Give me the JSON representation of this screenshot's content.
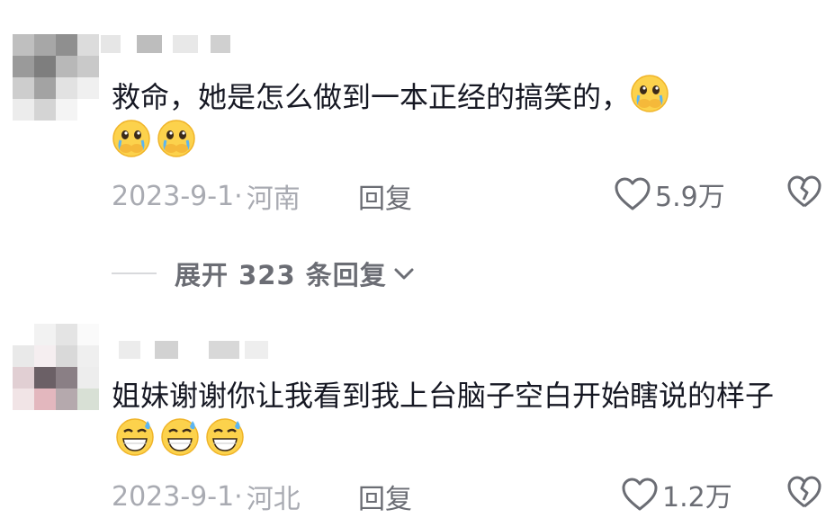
{
  "comments": [
    {
      "text": "救命，她是怎么做到一本正经的搞笑的，",
      "emoji": "crying-pleading-face",
      "date": "2023-9-1·",
      "location": "河南",
      "reply_label": "回复",
      "likes": "5.9万"
    },
    {
      "text": "姐妹谢谢你让我看到我上台脑子空白开始瞎说的样子",
      "emoji": "grinning-sweat-face",
      "date": "2023-9-1·",
      "location": "河北",
      "reply_label": "回复",
      "likes": "1.2万"
    }
  ],
  "expand_replies": {
    "label": "展开 323 条回复"
  },
  "colors": {
    "text": "#161823",
    "meta": "#a9abb2",
    "action": "#6b6d74",
    "divider": "#d8d9dc"
  }
}
